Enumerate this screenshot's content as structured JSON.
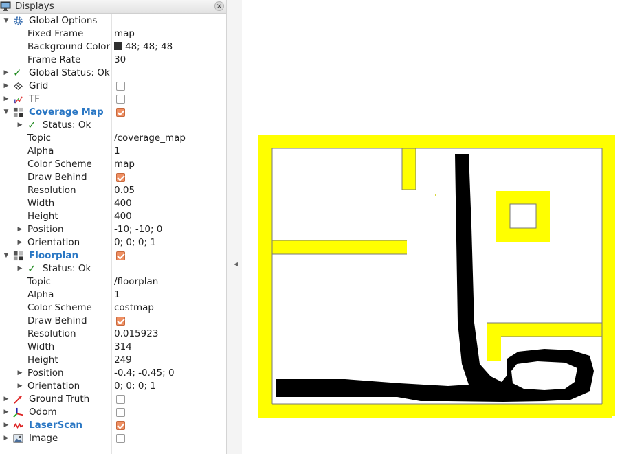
{
  "panel": {
    "title": "Displays",
    "close_glyph": "×"
  },
  "tree": {
    "global_options": {
      "label": "Global Options",
      "fixed_frame": {
        "label": "Fixed Frame",
        "value": "map"
      },
      "background_color": {
        "label": "Background Color",
        "value": "48; 48; 48",
        "swatch": "#303030"
      },
      "frame_rate": {
        "label": "Frame Rate",
        "value": "30"
      }
    },
    "global_status": {
      "label": "Global Status: Ok"
    },
    "grid": {
      "label": "Grid",
      "enabled": false
    },
    "tf": {
      "label": "TF",
      "enabled": false
    },
    "coverage_map": {
      "label": "Coverage Map",
      "enabled": true,
      "status": "Status: Ok",
      "topic": {
        "label": "Topic",
        "value": "/coverage_map"
      },
      "alpha": {
        "label": "Alpha",
        "value": "1"
      },
      "color_scheme": {
        "label": "Color Scheme",
        "value": "map"
      },
      "draw_behind": {
        "label": "Draw Behind",
        "enabled": true
      },
      "resolution": {
        "label": "Resolution",
        "value": "0.05"
      },
      "width": {
        "label": "Width",
        "value": "400"
      },
      "height": {
        "label": "Height",
        "value": "400"
      },
      "position": {
        "label": "Position",
        "value": "-10; -10; 0"
      },
      "orientation": {
        "label": "Orientation",
        "value": "0; 0; 0; 1"
      }
    },
    "floorplan": {
      "label": "Floorplan",
      "enabled": true,
      "status": "Status: Ok",
      "topic": {
        "label": "Topic",
        "value": "/floorplan"
      },
      "alpha": {
        "label": "Alpha",
        "value": "1"
      },
      "color_scheme": {
        "label": "Color Scheme",
        "value": "costmap"
      },
      "draw_behind": {
        "label": "Draw Behind",
        "enabled": true
      },
      "resolution": {
        "label": "Resolution",
        "value": "0.015923"
      },
      "width": {
        "label": "Width",
        "value": "314"
      },
      "height": {
        "label": "Height",
        "value": "249"
      },
      "position": {
        "label": "Position",
        "value": "-0.4; -0.45; 0"
      },
      "orientation": {
        "label": "Orientation",
        "value": "0; 0; 0; 1"
      }
    },
    "ground_truth": {
      "label": "Ground Truth",
      "enabled": false
    },
    "odom": {
      "label": "Odom",
      "enabled": false
    },
    "laser_scan": {
      "label": "LaserScan",
      "enabled": true
    },
    "image": {
      "label": "Image",
      "enabled": false
    }
  },
  "glyphs": {
    "expanded": "▼",
    "collapsed": "▶",
    "check": "✓",
    "split_arrow": "◀"
  },
  "colors": {
    "accent_blue": "#2a77c4",
    "checkbox_on": "#ef8f62",
    "status_ok": "#1f8a1f",
    "map_wall": "#ffff00",
    "map_path": "#000000",
    "map_free": "#ffffff"
  }
}
